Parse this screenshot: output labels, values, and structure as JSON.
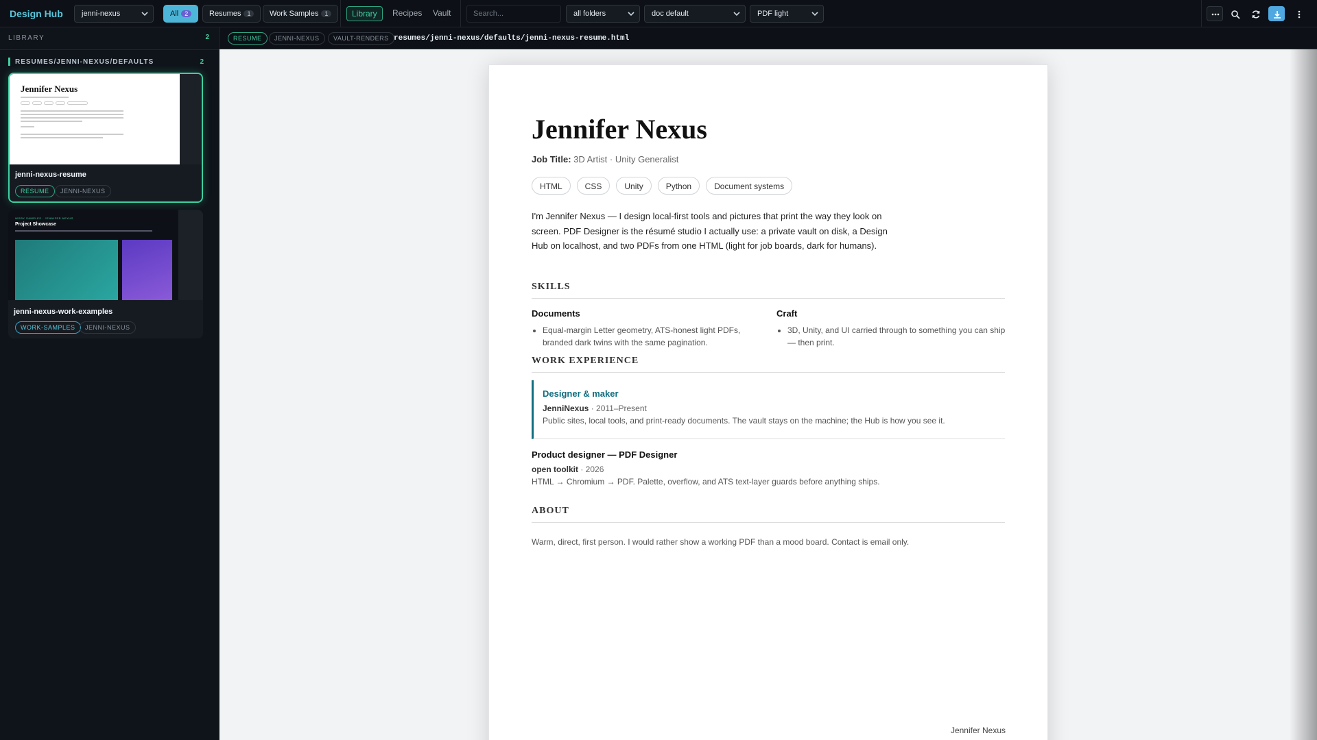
{
  "app": {
    "brand": "Design Hub",
    "profile_select": "jenni-nexus",
    "filters": [
      {
        "label": "All",
        "count": "2"
      },
      {
        "label": "Resumes",
        "count": "1"
      },
      {
        "label": "Work Samples",
        "count": "1"
      }
    ],
    "nav": [
      "Library",
      "Recipes",
      "Vault"
    ],
    "search_placeholder": "Search...",
    "folder_select": "all folders",
    "doc_select": "doc default",
    "pdf_select": "PDF light",
    "icons": [
      "more-icon",
      "search-icon",
      "refresh-icon",
      "download-icon",
      "kebab-menu-icon"
    ],
    "accent": "#3fd0a0",
    "brand_color": "#58c6dc"
  },
  "sidebar": {
    "header": "LIBRARY",
    "count": "2",
    "group": {
      "name": "RESUMES/JENNI-NEXUS/DEFAULTS",
      "count": "2"
    },
    "cards": [
      {
        "title": "jenni-nexus-resume",
        "tags": [
          "RESUME",
          "JENNI-NEXUS"
        ],
        "thumb_title": "Jennifer Nexus",
        "selected": true
      },
      {
        "title": "jenni-nexus-work-examples",
        "tags": [
          "WORK-SAMPLES",
          "JENNI-NEXUS"
        ],
        "thumb_title": "Project Showcase",
        "selected": false
      }
    ]
  },
  "pathbar": {
    "tags": [
      "RESUME",
      "JENNI-NEXUS",
      "VAULT-RENDERS"
    ],
    "path": "resumes/jenni-nexus/defaults/jenni-nexus-resume.html"
  },
  "resume": {
    "name": "Jennifer Nexus",
    "job_title_label": "Job Title:",
    "job_title": "3D Artist · Unity Generalist",
    "chips": [
      "HTML",
      "CSS",
      "Unity",
      "Python",
      "Document systems"
    ],
    "intro": "I'm Jennifer Nexus — I design local-first tools and pictures that print the way they look on screen. PDF Designer is the résumé studio I actually use: a private vault on disk, a Design Hub on localhost, and two PDFs from one HTML (light for job boards, dark for humans).",
    "skills_heading": "SKILLS",
    "skills": [
      {
        "title": "Documents",
        "item": "Equal-margin Letter geometry, ATS-honest light PDFs, branded dark twins with the same pagination."
      },
      {
        "title": "Craft",
        "item": "3D, Unity, and UI carried through to something you can ship — then print."
      }
    ],
    "experience_heading": "WORK EXPERIENCE",
    "jobs": [
      {
        "role": "Designer & maker",
        "company": "JenniNexus",
        "dates": "2011–Present",
        "desc": "Public sites, local tools, and print-ready documents. The vault stays on the machine; the Hub is how you see it."
      },
      {
        "role": "Product designer — PDF Designer",
        "company": "open toolkit",
        "dates": "2026",
        "desc": "HTML → Chromium → PDF. Palette, overflow, and ATS text-layer guards before anything ships."
      }
    ],
    "about_heading": "ABOUT",
    "about": "Warm, direct, first person. I would rather show a working PDF than a mood board. Contact is email only.",
    "footer_name": "Jennifer Nexus"
  }
}
